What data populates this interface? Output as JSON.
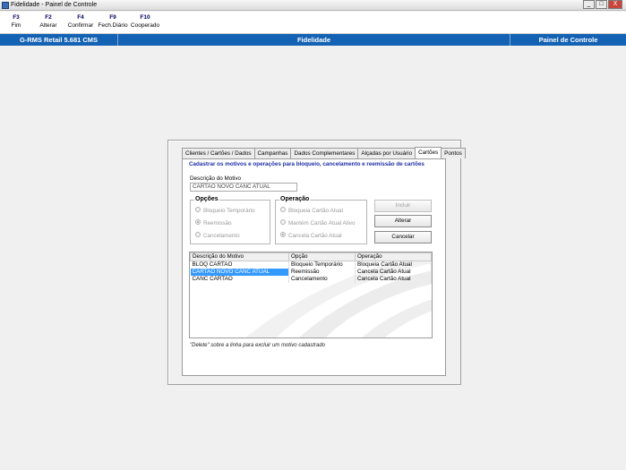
{
  "window": {
    "title": "Fidelidade - Painel de Controle",
    "minimize": "_",
    "maximize": "□",
    "close": "X"
  },
  "toolbar": [
    {
      "key": "F3",
      "label": "Fim"
    },
    {
      "key": "F2",
      "label": "Alterar"
    },
    {
      "key": "F4",
      "label": "Confirmar"
    },
    {
      "key": "F9",
      "label": "Fech.Diário"
    },
    {
      "key": "F10",
      "label": "Cooperado"
    }
  ],
  "status": {
    "left": "G-RMS Retail 5.681 CMS",
    "center": "Fidelidade",
    "right": "Painel de Controle"
  },
  "tabs": [
    "Clientes / Cartões / Dados",
    "Campanhas",
    "Dados Complementares",
    "Alçadas por Usuário",
    "Cartões",
    "Pontos"
  ],
  "active_tab": "Cartões",
  "form": {
    "heading": "Cadastrar os motivos e operações para bloqueio, cancelamento e reemissão de cartões",
    "desc_label": "Descrição do Motivo",
    "desc_value": "CARTAO NOVO CANC ATUAL",
    "opcoes_title": "Opções",
    "opcoes": [
      "Bloqueio Temporário",
      "Reemissão",
      "Cancelamento"
    ],
    "opcoes_selected": "Reemissão",
    "operacao_title": "Operação",
    "operacao": [
      "Bloqueia Cartão Atual",
      "Mantém Cartão Atual Ativo",
      "Cancela Cartão Atual"
    ],
    "operacao_selected": "Cancela Cartão Atual",
    "buttons": {
      "incluir": "Incluir",
      "alterar": "Alterar",
      "cancelar": "Cancelar"
    }
  },
  "grid": {
    "columns": [
      "Descrição do Motivo",
      "Opção",
      "Operação"
    ],
    "rows": [
      [
        "BLOQ CARTAO",
        "Bloqueio Temporário",
        "Bloqueia Cartão Atual"
      ],
      [
        "CARTAO NOVO CANC ATUAL",
        "Reemissão",
        "Cancela Cartão Atual"
      ],
      [
        "CANC CARTAO",
        "Cancelamento",
        "Cancela Cartão Atual"
      ]
    ],
    "selected_row": 1
  },
  "hint": "\"Delete\" sobre a linha para excluir um motivo cadastrado"
}
